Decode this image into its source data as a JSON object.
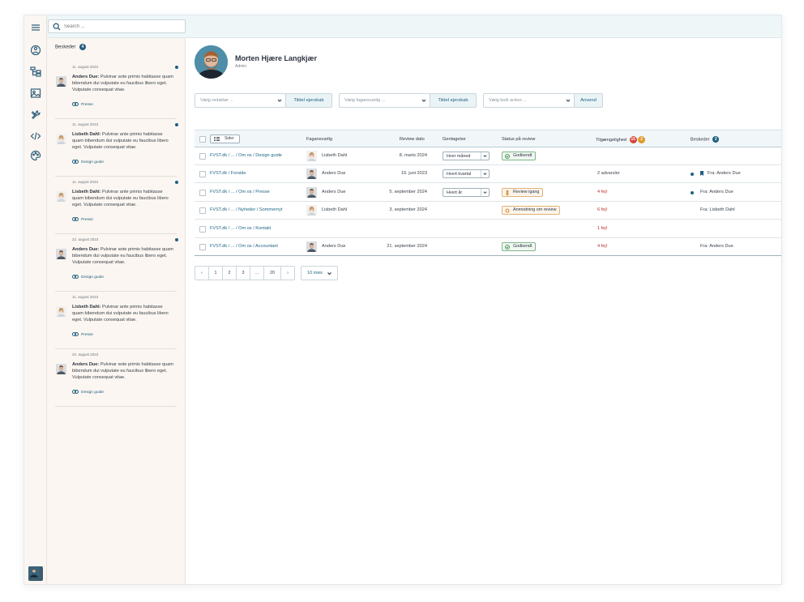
{
  "rail": {
    "icons": [
      "menu-icon",
      "dashboard-icon",
      "sitemap-icon",
      "image-icon",
      "tools-icon",
      "code-icon",
      "palette-icon"
    ]
  },
  "search": {
    "placeholder": "Search ..."
  },
  "messages": {
    "title": "Beskeder",
    "count": "4",
    "items": [
      {
        "date": "11. august 2023",
        "author": "Anders Due:",
        "text": "Pulvinar ante primis habitasse quam bibendum dui vulputate eu faucibus libero eget. Vulputate consequat vitae.",
        "tag": "Presse",
        "unread": true,
        "person": "anders"
      },
      {
        "date": "11. august 2023",
        "author": "Lisbeth Dahl:",
        "text": "Pulvinar ante primis habitasse quam bibendum dui vulputate eu faucibus libero eget. Vulputate consequat vitae.",
        "tag": "Design guide",
        "unread": true,
        "person": "lisbeth"
      },
      {
        "date": "11. august 2023",
        "author": "Lisbeth Dahl:",
        "text": "Pulvinar ante primis habitasse quam bibendum dui vulputate eu faucibus libero eget. Vulputate consequat vitae.",
        "tag": "Presse",
        "unread": true,
        "person": "lisbeth"
      },
      {
        "date": "22. august 2023",
        "author": "Anders Due:",
        "text": "Pulvinar ante primis habitasse quam bibendum dui vulputate eu faucibus libero eget. Vulputate consequat vitae.",
        "tag": "Design guide",
        "unread": true,
        "person": "anders"
      },
      {
        "date": "11. august 2023",
        "author": "Lisbeth Dahl:",
        "text": "Pulvinar ante primis habitasse quam bibendum dui vulputate eu faucibus libero eget. Vulputate consequat vitae.",
        "tag": "Presse",
        "unread": false,
        "person": "lisbeth"
      },
      {
        "date": "22. august 2023",
        "author": "Anders Due:",
        "text": "Pulvinar ante primis habitasse quam bibendum dui vulputate eu faucibus libero eget. Vulputate consequat vitae.",
        "tag": "Design guide",
        "unread": false,
        "person": "anders"
      }
    ]
  },
  "profile": {
    "name": "Morten Hjære Langkjær",
    "role": "Admin"
  },
  "controls": {
    "editor_placeholder": "Vælg redaktør ...",
    "assign_label": "Tildel ejerskab",
    "owner_placeholder": "Vælg fagansvarlig ...",
    "assign_label2": "Tildel ejerskab",
    "bulk_placeholder": "Vælg bulk action ...",
    "apply_label": "Anvend"
  },
  "table": {
    "pages_button": "Sider",
    "headers": {
      "owner": "Fagansvarlig",
      "review_date": "Review dato",
      "repeat": "Gentagelse",
      "status": "Status på review",
      "accessibility": "Tilgængelighed",
      "messages": "Beskeder"
    },
    "accessibility_counts": [
      "15",
      "2"
    ],
    "messages_count": "2",
    "rows": [
      {
        "path": "FVST.dk / ... / Om os / Design guide",
        "owner": "Lisbeth Dahl",
        "person": "lisbeth",
        "date": "8. marts 2024",
        "repeat": "Hver måned",
        "status": "Godkendt",
        "status_type": "green",
        "access": "",
        "access_type": "",
        "msg": "",
        "msg_dot": false,
        "msg_flag": false
      },
      {
        "path": "FVST.dk / Forside",
        "owner": "Anders Due",
        "person": "anders",
        "date": "10. juni 2023",
        "repeat": "Hvert kvartal",
        "status": "",
        "status_type": "",
        "access": "2 advarsler",
        "access_type": "warn",
        "msg": "Fra: Anders Due",
        "msg_dot": true,
        "msg_flag": true
      },
      {
        "path": "FVST.dk / ... / Om os / Presse",
        "owner": "Anders Due",
        "person": "anders",
        "date": "5. september 2024",
        "repeat": "Hvert år",
        "status": "Review igang",
        "status_type": "orange",
        "access": "4 fejl",
        "access_type": "err",
        "msg": "Fra: Anders Due",
        "msg_dot": true,
        "msg_flag": false
      },
      {
        "path": "FVST.dk / ... / Nyheder / Sommernyt",
        "owner": "Lisbeth Dahl",
        "person": "lisbeth",
        "date": "3. september 2024",
        "repeat": "",
        "status": "Anmodning om review",
        "status_type": "orange-req",
        "access": "6 fejl",
        "access_type": "err",
        "msg": "Fra: Lisbeth Dahl",
        "msg_dot": false,
        "msg_flag": false
      },
      {
        "path": "FVST.dk / ... / Om os / Kontakt",
        "owner": "",
        "person": "",
        "date": "",
        "repeat": "",
        "status": "",
        "status_type": "",
        "access": "1 fejl",
        "access_type": "err",
        "msg": "",
        "msg_dot": false,
        "msg_flag": false
      },
      {
        "path": "FVST.dk / ... / Om os / Accountant",
        "owner": "Anders Due",
        "person": "anders",
        "date": "21. september 2024",
        "repeat": "",
        "status": "Godkendt",
        "status_type": "green",
        "access": "4 fejl",
        "access_type": "err",
        "msg": "Fra: Anders Due",
        "msg_dot": false,
        "msg_flag": false
      }
    ]
  },
  "pagination": {
    "prev": "‹",
    "pages": [
      "1",
      "2",
      "3",
      "...",
      "20"
    ],
    "next": "›",
    "rows_label": "10 rows"
  },
  "colors": {
    "accent": "#1f5f7f",
    "error": "#c03030",
    "badge_red": "#d9433a",
    "badge_orange": "#e09a2e",
    "success": "#4f9a5e"
  }
}
